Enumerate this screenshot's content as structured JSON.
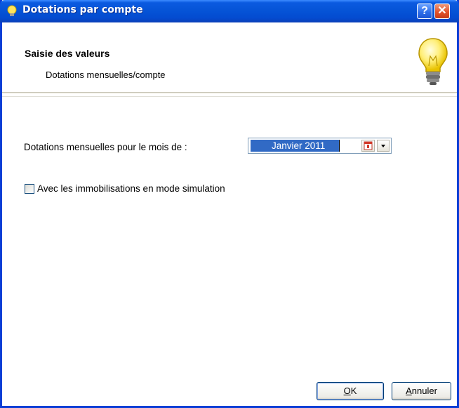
{
  "window": {
    "title": "Dotations par compte",
    "help_label": "?",
    "close_label": "✕"
  },
  "header": {
    "title": "Saisie des valeurs",
    "subtitle": "Dotations mensuelles/compte"
  },
  "form": {
    "month_label": "Dotations mensuelles pour le mois de :",
    "month_value": "Janvier 2011",
    "simulation_checkbox": {
      "label": "Avec les immobilisations en mode simulation",
      "checked": false
    }
  },
  "buttons": {
    "ok_first": "O",
    "ok_rest": "K",
    "cancel_first": "A",
    "cancel_rest": "nnuler"
  },
  "colors": {
    "titlebar": "#0553d6",
    "selection": "#316ac5",
    "close": "#e4522b"
  }
}
